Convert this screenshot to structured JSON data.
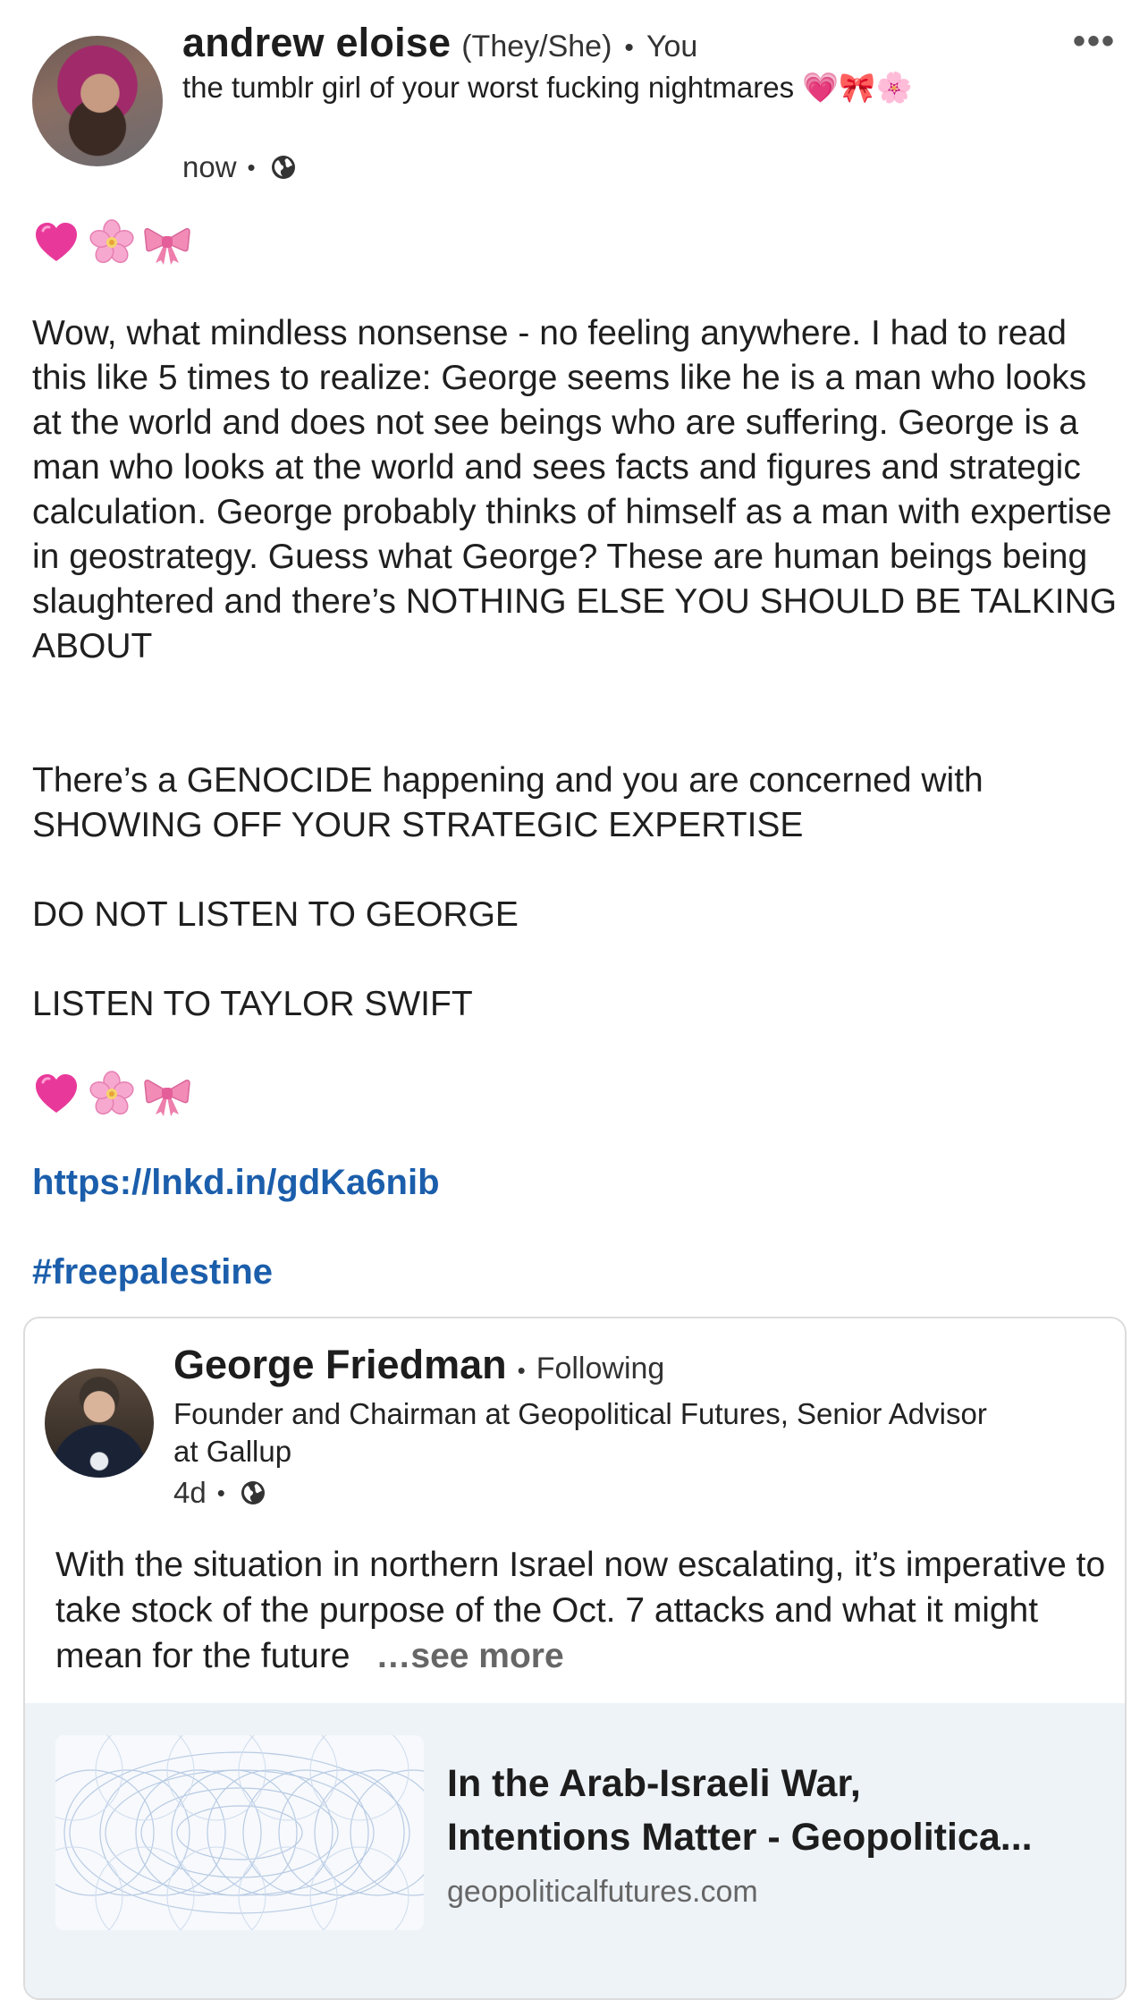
{
  "author": {
    "name": "andrew eloise",
    "pronouns": "(They/She)",
    "separator": "•",
    "relation": "You",
    "headline": "the tumblr girl of your worst fucking nightmares 💗🎀🌸",
    "time": "now",
    "meta_sep": "•",
    "more_icon": "more-options-icon"
  },
  "post": {
    "emoji_top": [
      "heart",
      "cherry-blossom",
      "ribbon"
    ],
    "para1": "Wow, what mindless nonsense - no feeling anywhere. I had to read this like 5 times to realize: George seems like he is a man who looks at the world and does not see beings who are suffering. George is a man who looks at the world and sees facts and figures and strategic calculation. George probably thinks of himself as a man with expertise in geostrategy. Guess what George? These are human beings being slaughtered and there’s NOTHING ELSE YOU SHOULD BE TALKING ABOUT",
    "para2": "There’s a GENOCIDE happening and you are concerned with SHOWING OFF YOUR STRATEGIC EXPERTISE",
    "para3": "DO NOT LISTEN TO GEORGE",
    "para4": "LISTEN TO TAYLOR SWIFT",
    "link": "https://lnkd.in/gdKa6nib",
    "hashtag": "#freepalestine"
  },
  "shared": {
    "name": "George Friedman",
    "separator": "•",
    "follow_status": "Following",
    "headline": "Founder and Chairman at Geopolitical Futures, Senior Advisor at Gallup",
    "time": "4d",
    "meta_sep": "•",
    "text": "With the situation in northern Israel now escalating, it’s imperative to take stock of the purpose of the Oct. 7 attacks and what it might mean for the future",
    "see_more": "…see more",
    "preview": {
      "title_line1": "In the Arab-Israeli War,",
      "title_line2": "Intentions Matter - Geopolitica...",
      "domain": "geopoliticalfutures.com"
    }
  },
  "colors": {
    "link": "#1b5eab",
    "preview_bg": "#eef3f8"
  }
}
